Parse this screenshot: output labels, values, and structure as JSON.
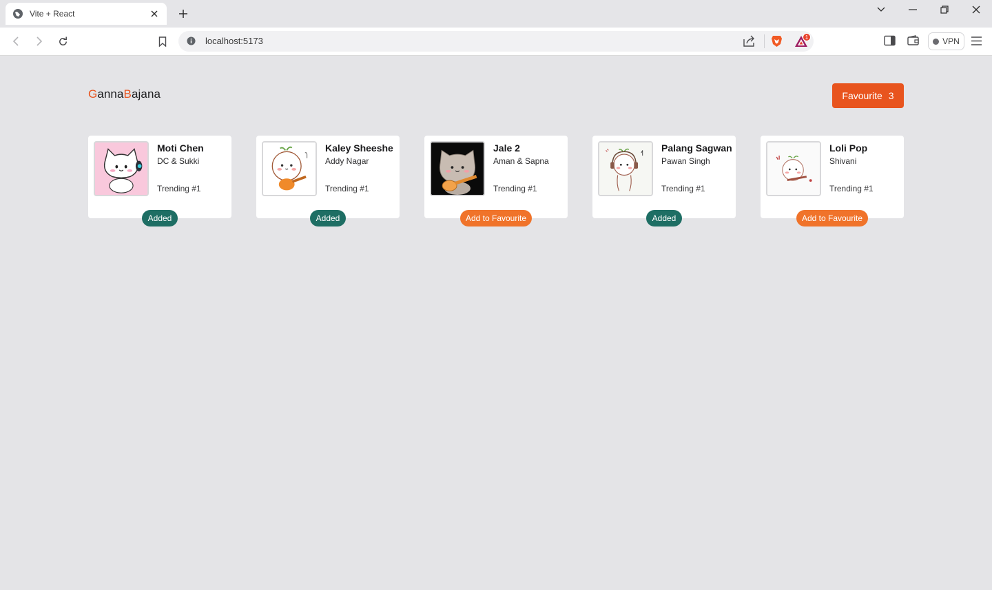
{
  "browser": {
    "tab_title": "Vite + React",
    "url": "localhost:5173",
    "vpn_label": "VPN",
    "notification_count": "1"
  },
  "header": {
    "logo_first_initial": "G",
    "logo_first_rest": "anna",
    "logo_second_initial": "B",
    "logo_second_rest": "ajana",
    "favourite_label": "Favourite",
    "favourite_count": "3",
    "accent_color": "#e8541e"
  },
  "songs": [
    {
      "title": "Moti Chen",
      "artist": "DC & Sukki",
      "trending": "Trending #1",
      "button": "Added",
      "favourited": true
    },
    {
      "title": "Kaley Sheeshe",
      "artist": "Addy Nagar",
      "trending": "Trending #1",
      "button": "Added",
      "favourited": true
    },
    {
      "title": "Jale 2",
      "artist": "Aman & Sapna",
      "trending": "Trending #1",
      "button": "Add to Favourite",
      "favourited": false
    },
    {
      "title": "Palang Sagwan",
      "artist": "Pawan Singh",
      "trending": "Trending #1",
      "button": "Added",
      "favourited": true
    },
    {
      "title": "Loli Pop",
      "artist": "Shivani",
      "trending": "Trending #1",
      "button": "Add to Favourite",
      "favourited": false
    }
  ],
  "colors": {
    "added": "#1e6e64",
    "add_to_favourite": "#f0732a",
    "page_background": "#e4e4e7"
  }
}
